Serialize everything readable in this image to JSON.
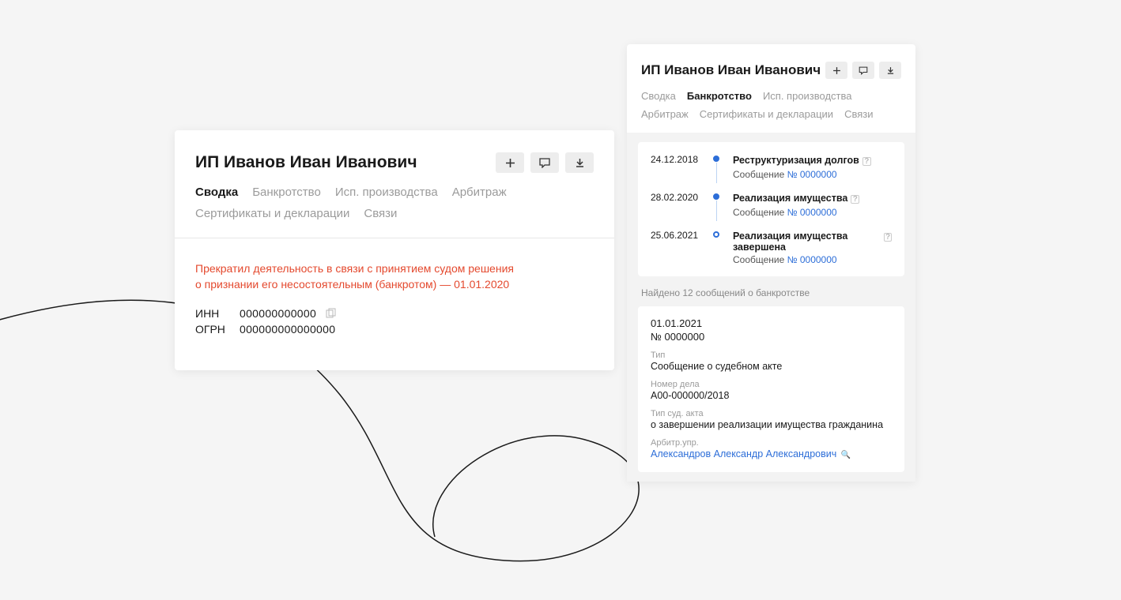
{
  "left": {
    "title": "ИП Иванов Иван Иванович",
    "tabs": [
      "Сводка",
      "Банкротство",
      "Исп. производства",
      "Арбитраж",
      "Сертификаты и декларации",
      "Связи"
    ],
    "active_tab_index": 0,
    "status_line1": "Прекратил деятельность в связи с принятием судом решения",
    "status_line2": "о признании его несостоятельным (банкротом) — 01.01.2020",
    "inn_label": "ИНН",
    "inn": "000000000000",
    "ogrn_label": "ОГРН",
    "ogrn": "000000000000000"
  },
  "right": {
    "title": "ИП Иванов Иван Иванович",
    "tabs": [
      "Сводка",
      "Банкротство",
      "Исп. производства",
      "Арбитраж",
      "Сертификаты и декларации",
      "Связи"
    ],
    "active_tab_index": 1,
    "timeline": [
      {
        "date": "24.12.2018",
        "title": "Реструктуризация долгов",
        "sub_prefix": "Сообщение ",
        "sub_link": "№ 0000000",
        "filled": true
      },
      {
        "date": "28.02.2020",
        "title": "Реализация имущества",
        "sub_prefix": "Сообщение ",
        "sub_link": "№ 0000000",
        "filled": true
      },
      {
        "date": "25.06.2021",
        "title": "Реализация имущества завершена",
        "sub_prefix": "Сообщение ",
        "sub_link": "№ 0000000",
        "filled": false,
        "halo": true
      }
    ],
    "found_text": "Найдено 12 сообщений о банкротстве",
    "message": {
      "date": "01.01.2021",
      "num": "№ 0000000",
      "fields": [
        {
          "label": "Тип",
          "value": "Сообщение о судебном акте"
        },
        {
          "label": "Номер дела",
          "value": "A00-000000/2018"
        },
        {
          "label": "Тип суд. акта",
          "value": "о завершении реализации имущества гражданина"
        },
        {
          "label": "Арбитр.упр.",
          "value": "Александров Александр Александрович",
          "link": true,
          "mag": true
        }
      ]
    }
  }
}
